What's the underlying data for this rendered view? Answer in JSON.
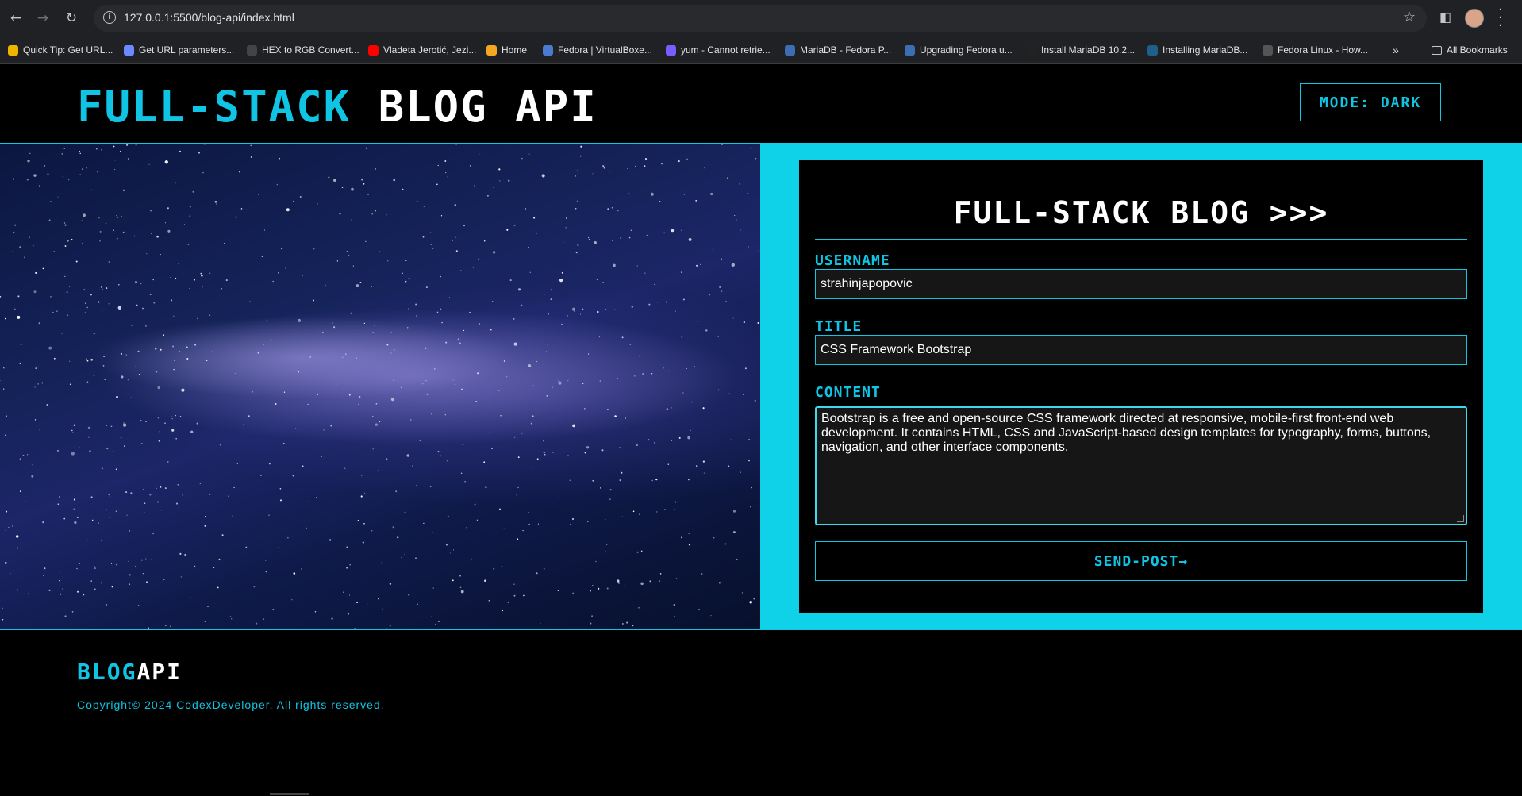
{
  "browser": {
    "url": "127.0.0.1:5500/blog-api/index.html",
    "all_bookmarks_label": "All Bookmarks",
    "bookmarks": [
      {
        "label": "Quick Tip: Get URL...",
        "color": "#f0b400"
      },
      {
        "label": "Get URL parameters...",
        "color": "#6a8aff"
      },
      {
        "label": "HEX to RGB Convert...",
        "color": "#444444"
      },
      {
        "label": "Vladeta Jerotić, Jezi...",
        "color": "#ff0000"
      },
      {
        "label": "Home",
        "color": "#f5a623"
      },
      {
        "label": "Fedora | VirtualBoxe...",
        "color": "#4a7bd0"
      },
      {
        "label": "yum - Cannot retrie...",
        "color": "#7a5cff"
      },
      {
        "label": "MariaDB - Fedora P...",
        "color": "#3c6eb4"
      },
      {
        "label": "Upgrading Fedora u...",
        "color": "#3c6eb4"
      },
      {
        "label": "Install MariaDB 10.2...",
        "color": "#222222"
      },
      {
        "label": "Installing MariaDB...",
        "color": "#1f5f8b"
      },
      {
        "label": "Fedora Linux - How...",
        "color": "#555555"
      }
    ]
  },
  "header": {
    "title_accent": "Full-Stack",
    "title_rest": "Blog API",
    "mode_button": "Mode: Dark"
  },
  "form": {
    "heading": "Full-Stack Blog >>>",
    "username_label": "Username",
    "username_value": "strahinjapopovic",
    "title_label": "Title",
    "title_value": "CSS Framework Bootstrap",
    "content_label": "Content",
    "content_value": "Bootstrap is a free and open-source CSS framework directed at responsive, mobile-first front-end web development. It contains HTML, CSS and JavaScript-based design templates for typography, forms, buttons, navigation, and other interface components.",
    "send_button": "Send-Post→"
  },
  "footer": {
    "logo_accent": "Blog",
    "logo_rest": "API",
    "copyright": "Copyright© 2024 CodexDeveloper. All rights reserved."
  },
  "colors": {
    "accent": "#0fc5e3",
    "panel": "#0fd1e8",
    "background": "#000000"
  }
}
